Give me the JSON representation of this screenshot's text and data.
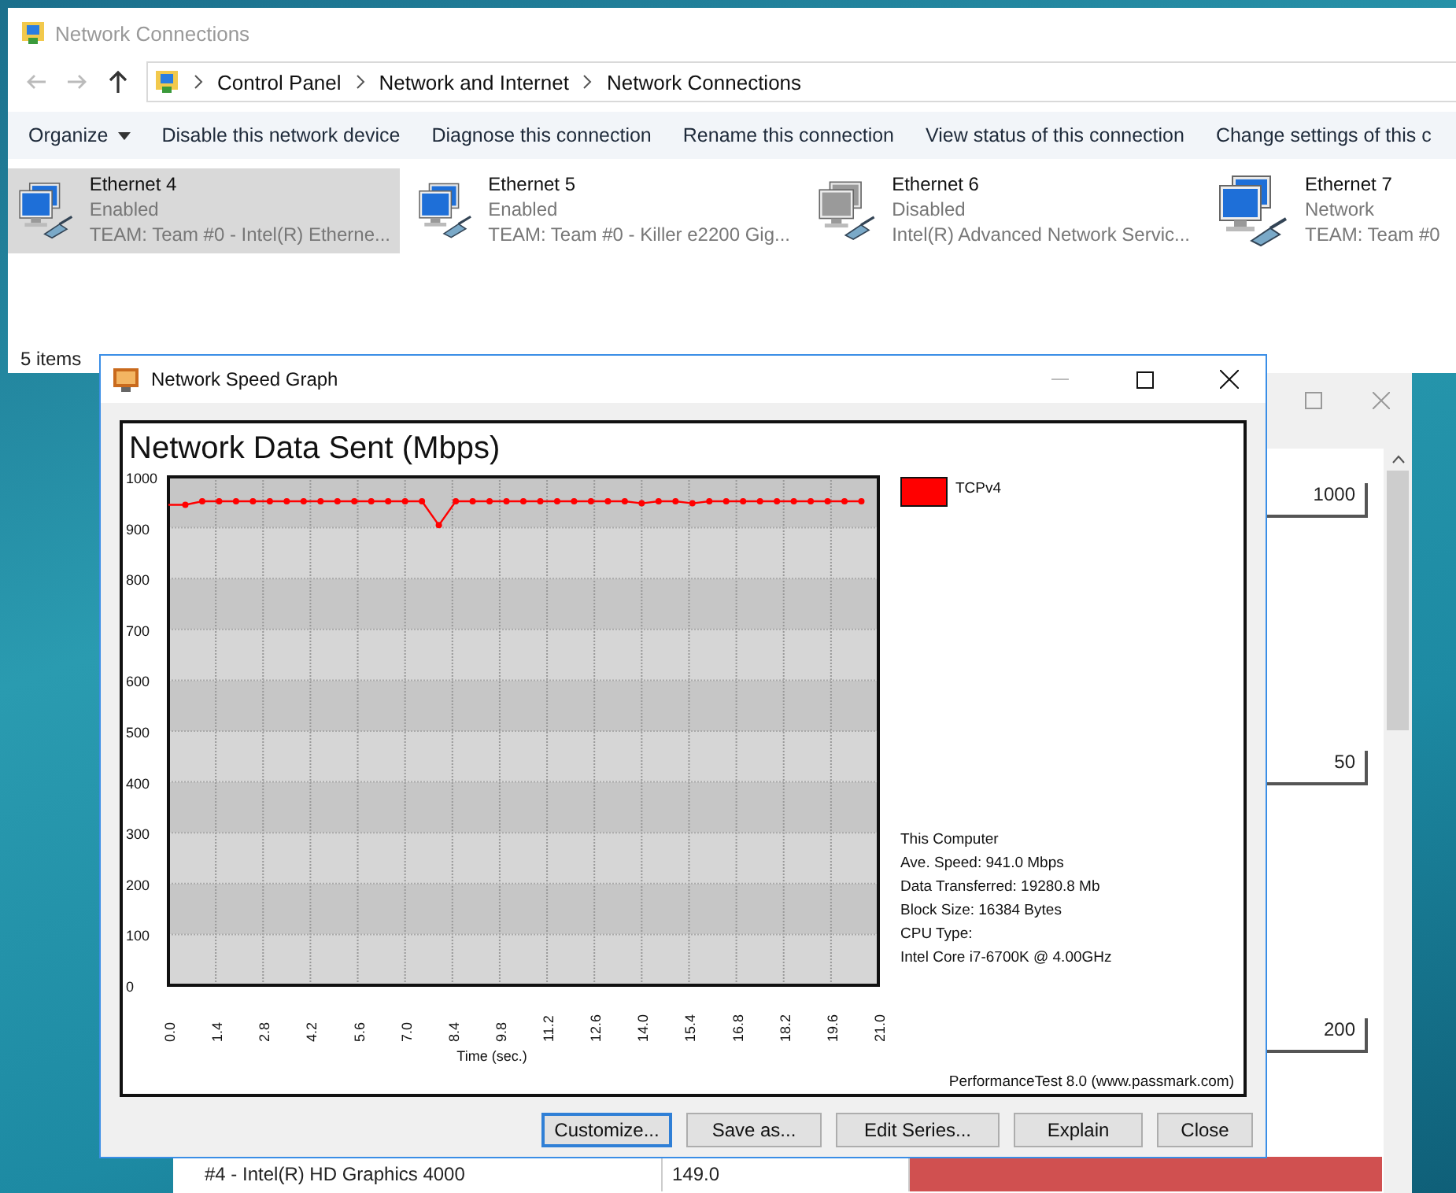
{
  "connections_window": {
    "title": "Network Connections",
    "breadcrumb": [
      "Control Panel",
      "Network and Internet",
      "Network Connections"
    ],
    "commands": [
      {
        "label": "Organize",
        "kind": "menu"
      },
      {
        "label": "Disable this network device",
        "kind": "action"
      },
      {
        "label": "Diagnose this connection",
        "kind": "action"
      },
      {
        "label": "Rename this connection",
        "kind": "action"
      },
      {
        "label": "View status of this connection",
        "kind": "action"
      },
      {
        "label": "Change settings of this c",
        "kind": "action"
      }
    ],
    "items": [
      {
        "name": "Ethernet 4",
        "status": "Enabled",
        "device": "TEAM: Team #0 - Intel(R) Etherne...",
        "disabled": false,
        "selected": true
      },
      {
        "name": "Ethernet 5",
        "status": "Enabled",
        "device": "TEAM: Team #0 - Killer e2200 Gig...",
        "disabled": false,
        "selected": false
      },
      {
        "name": "Ethernet 6",
        "status": "Disabled",
        "device": "Intel(R) Advanced Network Servic...",
        "disabled": true,
        "selected": false
      },
      {
        "name": "Ethernet 7",
        "status": "Network",
        "device": "TEAM: Team #0",
        "disabled": false,
        "selected": false
      }
    ],
    "status_bar": "5 items"
  },
  "background_window": {
    "scale_labels": [
      "1000",
      "50",
      "200"
    ],
    "row": {
      "name": "#4 - Intel(R) HD Graphics 4000",
      "value": "149.0"
    }
  },
  "graph_window": {
    "title": "Network Speed Graph",
    "heading": "Network Data Sent (Mbps)",
    "chart_data": {
      "type": "line",
      "grid": true,
      "xlabel": "Time (sec.)",
      "ylim": [
        0,
        1000
      ],
      "xlim": [
        0,
        21
      ],
      "yticks": [
        0,
        100,
        200,
        300,
        400,
        500,
        600,
        700,
        800,
        900,
        1000
      ],
      "xticks": [
        {
          "value": 0,
          "label": "0.0"
        },
        {
          "value": 1.4,
          "label": "1.4"
        },
        {
          "value": 2.8,
          "label": "2.8"
        },
        {
          "value": 4.2,
          "label": "4.2"
        },
        {
          "value": 5.6,
          "label": "5.6"
        },
        {
          "value": 7,
          "label": "7.0"
        },
        {
          "value": 8.4,
          "label": "8.4"
        },
        {
          "value": 9.8,
          "label": "9.8"
        },
        {
          "value": 11.2,
          "label": "11.2"
        },
        {
          "value": 12.6,
          "label": "12.6"
        },
        {
          "value": 14,
          "label": "14.0"
        },
        {
          "value": 15.4,
          "label": "15.4"
        },
        {
          "value": 16.8,
          "label": "16.8"
        },
        {
          "value": 18.2,
          "label": "18.2"
        },
        {
          "value": 19.6,
          "label": "19.6"
        },
        {
          "value": 21,
          "label": "21.0"
        }
      ],
      "x": [
        0,
        0.5,
        1,
        1.5,
        2,
        2.5,
        3,
        3.5,
        4,
        4.5,
        5,
        5.5,
        6,
        6.5,
        7,
        7.5,
        8,
        8.5,
        9,
        9.5,
        10,
        10.5,
        11,
        11.5,
        12,
        12.5,
        13,
        13.5,
        14,
        14.5,
        15,
        15.5,
        16,
        16.5,
        17,
        17.5,
        18,
        18.5,
        19,
        19.5,
        20,
        20.5
      ],
      "series": [
        {
          "name": "TCPv4",
          "color": "#ff0000",
          "marker": "circle",
          "values": [
            945,
            945,
            952,
            952,
            952,
            952,
            952,
            952,
            952,
            952,
            952,
            952,
            952,
            952,
            952,
            952,
            905,
            952,
            952,
            952,
            952,
            952,
            952,
            952,
            952,
            952,
            952,
            952,
            948,
            952,
            952,
            948,
            952,
            952,
            952,
            952,
            952,
            952,
            952,
            952,
            952,
            952
          ]
        }
      ]
    },
    "info": [
      "This Computer",
      "Ave. Speed: 941.0 Mbps",
      "Data Transferred: 19280.8 Mb",
      "Block Size: 16384 Bytes",
      "CPU Type:",
      "Intel Core i7-6700K @ 4.00GHz"
    ],
    "credit": "PerformanceTest 8.0 (www.passmark.com)",
    "buttons": [
      {
        "label": "Customize...",
        "focused": true
      },
      {
        "label": "Save as...",
        "focused": false
      },
      {
        "label": "Edit Series...",
        "focused": false
      },
      {
        "label": "Explain",
        "focused": false
      },
      {
        "label": "Close",
        "focused": false
      }
    ]
  }
}
